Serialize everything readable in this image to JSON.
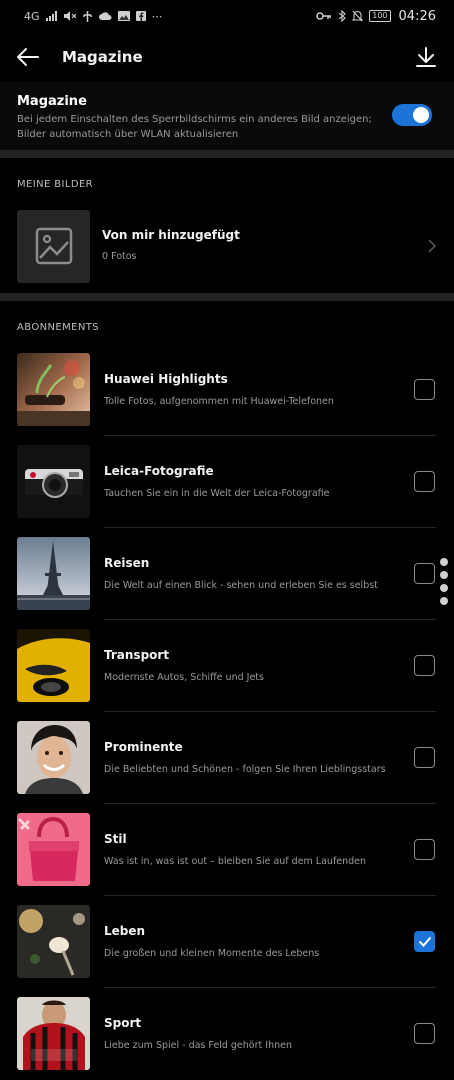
{
  "status_bar": {
    "network": "4G",
    "battery": "100",
    "time": "04:26",
    "icons": [
      "signal-icon",
      "mute-icon",
      "usb-icon",
      "cloud-icon",
      "photo-icon",
      "facebook-icon",
      "more-icon",
      "key-icon",
      "bluetooth-icon",
      "bell-off-icon"
    ]
  },
  "app_bar": {
    "title": "Magazine",
    "back_icon": "back-arrow-icon",
    "download_icon": "download-icon"
  },
  "magazine": {
    "title": "Magazine",
    "description": "Bei jedem Einschalten des Sperrbildschirms ein anderes Bild anzeigen; Bilder automatisch über WLAN aktualisieren",
    "enabled": true,
    "accent_color": "#1d74d8"
  },
  "my_pictures": {
    "section_label": "MEINE BILDER",
    "title": "Von mir hinzugefügt",
    "count": "0 Fotos"
  },
  "subscriptions": {
    "section_label": "ABONNEMENTS",
    "items": [
      {
        "title": "Huawei Highlights",
        "subtitle": "Tolle Fotos, aufgenommen mit Huawei-Telefonen",
        "checked": false
      },
      {
        "title": "Leica-Fotografie",
        "subtitle": "Tauchen Sie ein in die Welt der Leica-Fotografie",
        "checked": false
      },
      {
        "title": "Reisen",
        "subtitle": "Die Welt auf einen Blick - sehen und erleben Sie es selbst",
        "checked": false
      },
      {
        "title": "Transport",
        "subtitle": "Modernste Autos, Schiffe und Jets",
        "checked": false
      },
      {
        "title": "Prominente",
        "subtitle": "Die Beliebten und Schönen - folgen Sie Ihren Lieblingsstars",
        "checked": false
      },
      {
        "title": "Stil",
        "subtitle": "Was ist in, was ist out – bleiben Sie auf dem Laufenden",
        "checked": false
      },
      {
        "title": "Leben",
        "subtitle": "Die großen und kleinen Momente des Lebens",
        "checked": true
      },
      {
        "title": "Sport",
        "subtitle": "Liebe zum Spiel - das Feld gehört Ihnen",
        "checked": false
      }
    ]
  }
}
